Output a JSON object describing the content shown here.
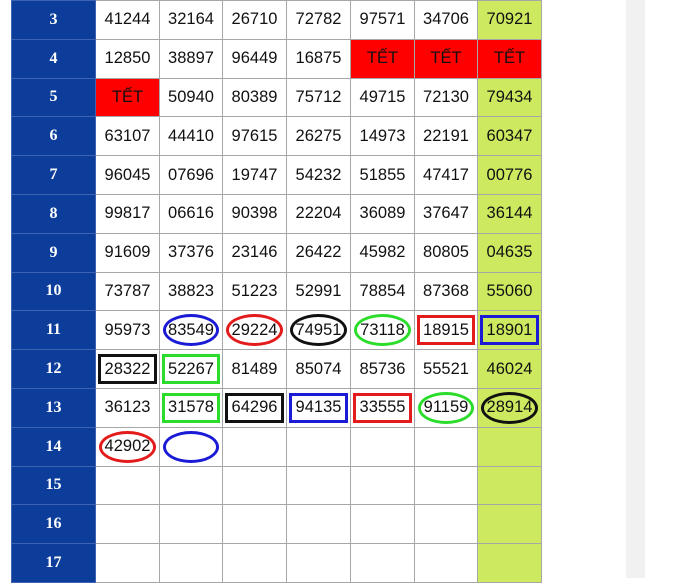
{
  "colors": {
    "row_header_bg": "#0d3d9a",
    "last_column_bg": "#cde95f",
    "tet_bg": "#ff0000",
    "mark_red": "#e31b1b",
    "mark_blue": "#1b1bd6",
    "mark_black": "#111111",
    "mark_green": "#2bdc2b"
  },
  "rows": [
    {
      "label": "3",
      "cells": [
        "41244",
        "32164",
        "26710",
        "72782",
        "97571",
        "34706",
        "70921"
      ]
    },
    {
      "label": "4",
      "cells": [
        "12850",
        "38897",
        "96449",
        "16875",
        "TẾT",
        "TẾT",
        "TẾT"
      ]
    },
    {
      "label": "5",
      "cells": [
        "TẾT",
        "50940",
        "80389",
        "75712",
        "49715",
        "72130",
        "79434"
      ]
    },
    {
      "label": "6",
      "cells": [
        "63107",
        "44410",
        "97615",
        "26275",
        "14973",
        "22191",
        "60347"
      ]
    },
    {
      "label": "7",
      "cells": [
        "96045",
        "07696",
        "19747",
        "54232",
        "51855",
        "47417",
        "00776"
      ]
    },
    {
      "label": "8",
      "cells": [
        "99817",
        "06616",
        "90398",
        "22204",
        "36089",
        "37647",
        "36144"
      ]
    },
    {
      "label": "9",
      "cells": [
        "91609",
        "37376",
        "23146",
        "26422",
        "45982",
        "80805",
        "04635"
      ]
    },
    {
      "label": "10",
      "cells": [
        "73787",
        "38823",
        "51223",
        "52991",
        "78854",
        "87368",
        "55060"
      ]
    },
    {
      "label": "11",
      "cells": [
        "95973",
        "83549",
        "29224",
        "74951",
        "73118",
        "18915",
        "18901"
      ]
    },
    {
      "label": "12",
      "cells": [
        "28322",
        "52267",
        "81489",
        "85074",
        "85736",
        "55521",
        "46024"
      ]
    },
    {
      "label": "13",
      "cells": [
        "36123",
        "31578",
        "64296",
        "94135",
        "33555",
        "91159",
        "28914"
      ]
    },
    {
      "label": "14",
      "cells": [
        "42902",
        "",
        "",
        "",
        "",
        "",
        ""
      ]
    },
    {
      "label": "15",
      "cells": [
        "",
        "",
        "",
        "",
        "",
        "",
        ""
      ]
    },
    {
      "label": "16",
      "cells": [
        "",
        "",
        "",
        "",
        "",
        "",
        ""
      ]
    },
    {
      "label": "17",
      "cells": [
        "",
        "",
        "",
        "",
        "",
        "",
        ""
      ]
    }
  ],
  "marks": [
    {
      "row": 8,
      "col": 1,
      "shape": "oval",
      "color": "blue"
    },
    {
      "row": 8,
      "col": 2,
      "shape": "oval",
      "color": "red"
    },
    {
      "row": 8,
      "col": 3,
      "shape": "oval",
      "color": "black"
    },
    {
      "row": 8,
      "col": 4,
      "shape": "oval",
      "color": "green"
    },
    {
      "row": 8,
      "col": 5,
      "shape": "rect",
      "color": "red"
    },
    {
      "row": 8,
      "col": 6,
      "shape": "rect",
      "color": "blue"
    },
    {
      "row": 9,
      "col": 0,
      "shape": "rect",
      "color": "black"
    },
    {
      "row": 9,
      "col": 1,
      "shape": "rect",
      "color": "green"
    },
    {
      "row": 10,
      "col": 1,
      "shape": "rect",
      "color": "green"
    },
    {
      "row": 10,
      "col": 2,
      "shape": "rect",
      "color": "black"
    },
    {
      "row": 10,
      "col": 3,
      "shape": "rect",
      "color": "blue"
    },
    {
      "row": 10,
      "col": 4,
      "shape": "rect",
      "color": "red"
    },
    {
      "row": 10,
      "col": 5,
      "shape": "oval",
      "color": "green"
    },
    {
      "row": 10,
      "col": 6,
      "shape": "oval",
      "color": "black"
    },
    {
      "row": 11,
      "col": 0,
      "shape": "oval",
      "color": "red"
    },
    {
      "row": 11,
      "col": 1,
      "shape": "oval",
      "color": "blue"
    }
  ]
}
